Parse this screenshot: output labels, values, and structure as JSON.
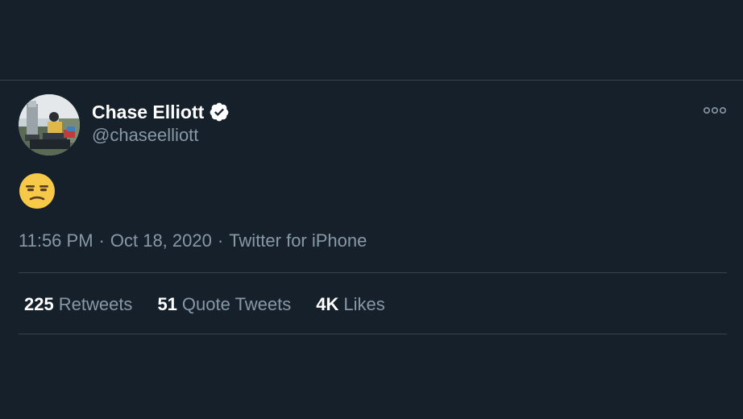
{
  "tweet": {
    "author": {
      "display_name": "Chase Elliott",
      "handle": "@chaseelliott",
      "verified": true
    },
    "content_emoji": "😒",
    "content_emoji_icon": "unamused-face-icon",
    "time": "11:56 PM",
    "date": "Oct 18, 2020",
    "separator": "·",
    "source": "Twitter for iPhone",
    "stats": [
      {
        "count": "225",
        "label": "Retweets"
      },
      {
        "count": "51",
        "label": "Quote Tweets"
      },
      {
        "count": "4K",
        "label": "Likes"
      }
    ]
  },
  "colors": {
    "background": "#15202b",
    "divider": "#38444d",
    "secondary_text": "#8899a6",
    "primary_text": "#ffffff",
    "verified_badge": "#ffffff"
  },
  "icons": {
    "more": "more-horizontal-icon",
    "verified": "verified-badge-icon"
  }
}
